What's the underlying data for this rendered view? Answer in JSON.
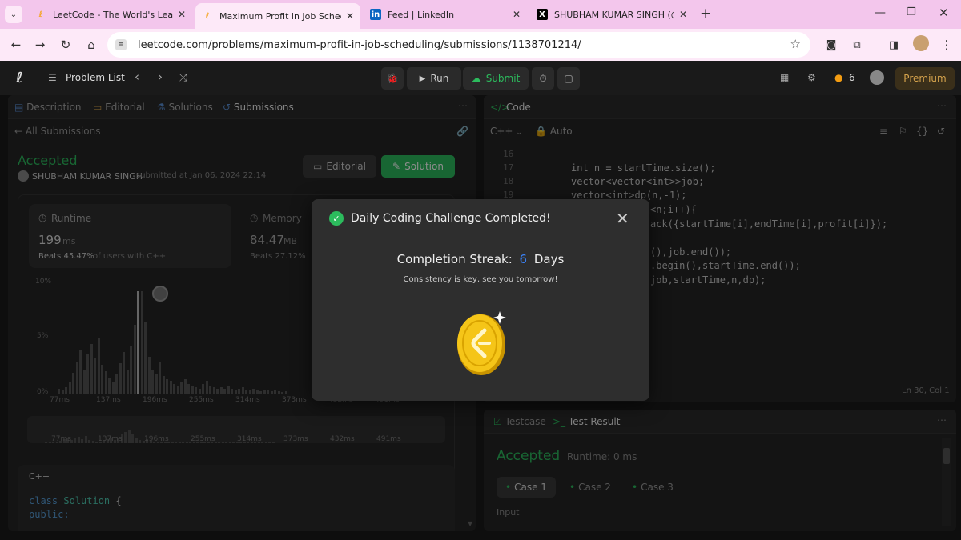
{
  "browser": {
    "tabs": [
      {
        "title": "LeetCode - The World's Leading",
        "icon": "leetcode-icon"
      },
      {
        "title": "Maximum Profit in Job Schedul",
        "icon": "leetcode-icon"
      },
      {
        "title": "Feed | LinkedIn",
        "icon": "linkedin-icon"
      },
      {
        "title": "SHUBHAM KUMAR SINGH (@s",
        "icon": "x-icon"
      }
    ],
    "url": "leetcode.com/problems/maximum-profit-in-job-scheduling/submissions/1138701214/"
  },
  "nav": {
    "problem_list": "Problem List",
    "run": "Run",
    "submit": "Submit",
    "streak_count": "6",
    "premium": "Premium"
  },
  "left_tabs": {
    "description": "Description",
    "editorial": "Editorial",
    "solutions": "Solutions",
    "submissions": "Submissions"
  },
  "submission": {
    "back": "All Submissions",
    "status": "Accepted",
    "user": "SHUBHAM KUMAR SINGH",
    "submitted_at": "submitted at Jan 06, 2024 22:14",
    "editorial_btn": "Editorial",
    "solution_btn": "Solution",
    "runtime_label": "Runtime",
    "runtime_value": "199",
    "runtime_unit": "ms",
    "runtime_beats_pct": "Beats 45.47%",
    "runtime_beats_suffix": "of users with C++",
    "memory_label": "Memory",
    "memory_value": "84.47",
    "memory_unit": "MB",
    "memory_beats_pct": "Beats 27.12%",
    "lang": "C++",
    "code_line1_kw": "class",
    "code_line1_name": "Solution",
    "code_line1_brace": "{",
    "code_line2": "public:"
  },
  "chart_data": {
    "type": "bar",
    "y_ticks": [
      "10%",
      "5%",
      "0%"
    ],
    "x_ticks": [
      "77ms",
      "137ms",
      "196ms",
      "255ms",
      "314ms",
      "373ms",
      "432ms",
      "491ms"
    ],
    "highlight_tick": "196ms",
    "ylim": [
      0,
      10
    ]
  },
  "code_panel": {
    "title": "Code",
    "lang": "C++",
    "mode": "Auto",
    "cursor": "Ln 30, Col 1",
    "line_numbers": [
      "16",
      "17",
      "18",
      "19"
    ],
    "lines": [
      "",
      "int n = startTime.size();",
      "vector<vector<int>>job;",
      "vector<int>dp(n,-1);",
      "<n;i++){",
      "ack({startTime[i],endTime[i],profit[i]});",
      "",
      "(),job.end());",
      ".begin(),startTime.end());",
      "job,startTime,n,dp);"
    ]
  },
  "result_panel": {
    "testcase_tab": "Testcase",
    "result_tab": "Test Result",
    "status": "Accepted",
    "runtime": "Runtime: 0 ms",
    "cases": [
      "Case 1",
      "Case 2",
      "Case 3"
    ],
    "input_label": "Input"
  },
  "modal": {
    "title": "Daily Coding Challenge Completed!",
    "streak_label": "Completion Streak:",
    "streak_value": "6",
    "streak_unit": "Days",
    "message": "Consistency is key, see you tomorrow!"
  },
  "colors": {
    "accepted": "#2cbb5d",
    "accent_blue": "#3b82f6",
    "coin": "#f5c518",
    "chrome_tabbar": "#f3c6ec"
  }
}
